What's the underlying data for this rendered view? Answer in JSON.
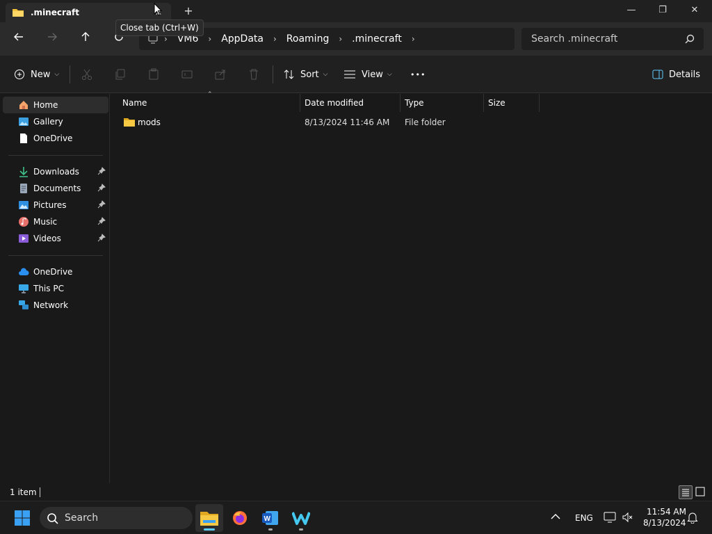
{
  "tab": {
    "title": ".minecraft",
    "close_tooltip": "Close tab (Ctrl+W)"
  },
  "window_controls": {
    "minimize": "—",
    "restore": "❐",
    "close": "✕"
  },
  "breadcrumb": [
    "VM6",
    "AppData",
    "Roaming",
    ".minecraft"
  ],
  "search": {
    "placeholder": "Search .minecraft"
  },
  "commands": {
    "new": "New",
    "sort": "Sort",
    "view": "View",
    "more": "•••",
    "details": "Details"
  },
  "sidebar": {
    "group1": [
      {
        "label": "Home",
        "icon": "home-icon"
      },
      {
        "label": "Gallery",
        "icon": "gallery-icon"
      },
      {
        "label": "OneDrive",
        "icon": "document-icon"
      }
    ],
    "group2": [
      {
        "label": "Downloads",
        "icon": "download-icon"
      },
      {
        "label": "Documents",
        "icon": "documents-icon"
      },
      {
        "label": "Pictures",
        "icon": "pictures-icon"
      },
      {
        "label": "Music",
        "icon": "music-icon"
      },
      {
        "label": "Videos",
        "icon": "videos-icon"
      }
    ],
    "group3": [
      {
        "label": "OneDrive",
        "icon": "cloud-icon"
      },
      {
        "label": "This PC",
        "icon": "pc-icon"
      },
      {
        "label": "Network",
        "icon": "network-icon"
      }
    ]
  },
  "columns": {
    "name": "Name",
    "date": "Date modified",
    "type": "Type",
    "size": "Size"
  },
  "files": [
    {
      "name": "mods",
      "date": "8/13/2024 11:46 AM",
      "type": "File folder",
      "size": ""
    }
  ],
  "status": {
    "count": "1 item"
  },
  "taskbar": {
    "search": "Search",
    "lang": "ENG",
    "time": "11:54 AM",
    "date": "8/13/2024"
  },
  "colors": {
    "accent": "#60cdff",
    "folder": "#f3c13a",
    "background": "#191919"
  }
}
